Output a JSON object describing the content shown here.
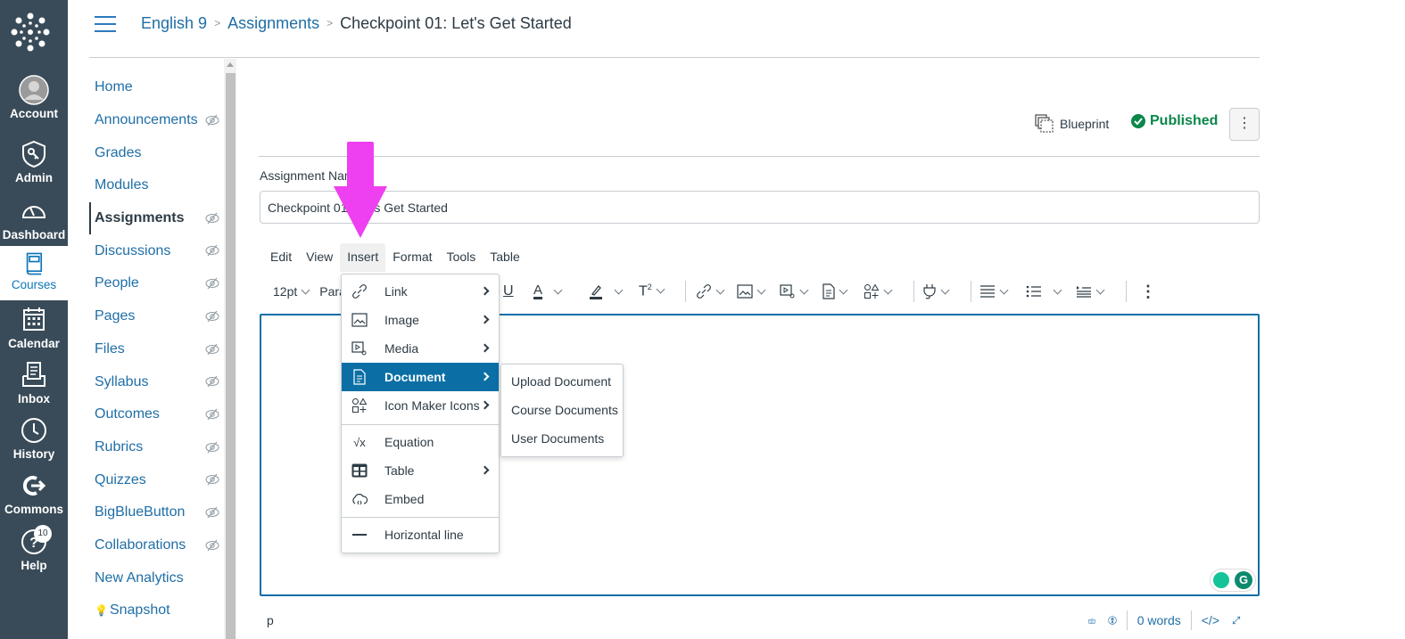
{
  "global_nav": {
    "items": [
      {
        "label": "Account",
        "icon": "account-avatar-icon"
      },
      {
        "label": "Admin",
        "icon": "admin-shield-icon"
      },
      {
        "label": "Dashboard",
        "icon": "dashboard-gauge-icon"
      },
      {
        "label": "Courses",
        "icon": "courses-book-icon",
        "active": true
      },
      {
        "label": "Calendar",
        "icon": "calendar-icon"
      },
      {
        "label": "Inbox",
        "icon": "inbox-icon"
      },
      {
        "label": "History",
        "icon": "history-clock-icon"
      },
      {
        "label": "Commons",
        "icon": "commons-icon"
      },
      {
        "label": "Help",
        "icon": "help-icon",
        "badge": "10"
      }
    ]
  },
  "breadcrumb": {
    "course": "English 9",
    "section": "Assignments",
    "current": "Checkpoint 01: Let's Get Started"
  },
  "course_nav": {
    "items": [
      {
        "label": "Home",
        "hidden": false
      },
      {
        "label": "Announcements",
        "hidden": true
      },
      {
        "label": "Grades",
        "hidden": false
      },
      {
        "label": "Modules",
        "hidden": false
      },
      {
        "label": "Assignments",
        "hidden": true,
        "active": true
      },
      {
        "label": "Discussions",
        "hidden": true
      },
      {
        "label": "People",
        "hidden": true
      },
      {
        "label": "Pages",
        "hidden": true
      },
      {
        "label": "Files",
        "hidden": true
      },
      {
        "label": "Syllabus",
        "hidden": true
      },
      {
        "label": "Outcomes",
        "hidden": true
      },
      {
        "label": "Rubrics",
        "hidden": true
      },
      {
        "label": "Quizzes",
        "hidden": true
      },
      {
        "label": "BigBlueButton",
        "hidden": true
      },
      {
        "label": "Collaborations",
        "hidden": true
      },
      {
        "label": "New Analytics",
        "hidden": false
      },
      {
        "label": "Snapshot",
        "hidden": false
      }
    ]
  },
  "actions": {
    "blueprint_label": "Blueprint",
    "published_label": "Published",
    "more_label": "⋮"
  },
  "form": {
    "name_label": "Assignment Name",
    "name_value": "Checkpoint 01: Let's Get Started"
  },
  "editor": {
    "menubar": [
      "Edit",
      "View",
      "Insert",
      "Format",
      "Tools",
      "Table"
    ],
    "open_menu": "Insert",
    "font_size": "12pt",
    "block_format": "Paragraph",
    "insert_menu": [
      {
        "label": "Link",
        "submenu": true
      },
      {
        "label": "Image",
        "submenu": true
      },
      {
        "label": "Media",
        "submenu": true
      },
      {
        "label": "Document",
        "submenu": true,
        "highlighted": true
      },
      {
        "label": "Icon Maker Icons",
        "submenu": true
      },
      {
        "label": "Equation",
        "submenu": false
      },
      {
        "label": "Table",
        "submenu": true
      },
      {
        "label": "Embed",
        "submenu": false
      },
      {
        "label": "Horizontal line",
        "submenu": false
      }
    ],
    "document_submenu": [
      "Upload Document",
      "Course Documents",
      "User Documents"
    ],
    "status_path": "p",
    "word_count": "0 words",
    "html_toggle": "</>"
  },
  "colors": {
    "nav_bg": "#394b58",
    "link": "#1f6ea6",
    "published": "#0b874b",
    "highlight": "#0b6fa6",
    "annotation_arrow": "#ee3ff0"
  }
}
